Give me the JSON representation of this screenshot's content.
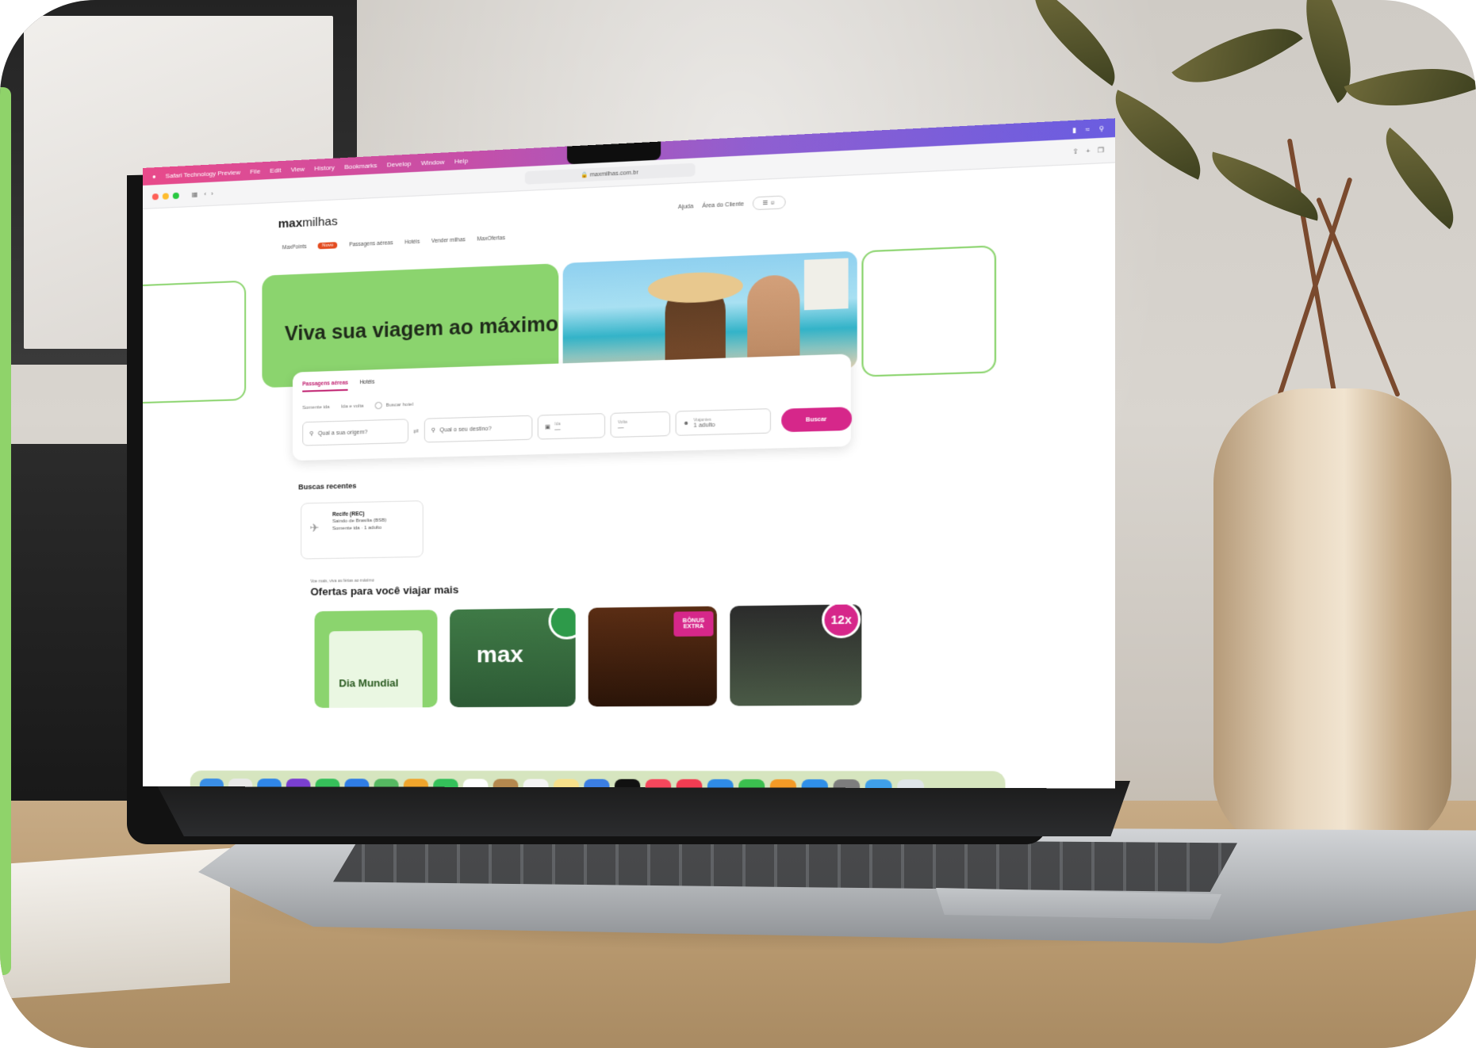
{
  "browser": {
    "menubar_items": [
      "Safari Technology Preview",
      "File",
      "Edit",
      "View",
      "History",
      "Bookmarks",
      "Develop",
      "Window",
      "Help"
    ],
    "url": "maxmilhas.com.br"
  },
  "site": {
    "logo_bold": "max",
    "logo_rest": "milhas",
    "header_links": [
      "Ajuda",
      "Área do Cliente"
    ],
    "nav_items": [
      "MaxPoints",
      "Passagens aéreas",
      "Hotéis",
      "Vender milhas",
      "MaxOfertas"
    ],
    "nav_new_badge": "Novo",
    "hero_title": "Viva sua viagem ao máximo",
    "search": {
      "tabs": [
        "Passagens aéreas",
        "Hotéis"
      ],
      "options": [
        "Somente ida",
        "Ida e volta",
        "Buscar hotel"
      ],
      "origin_placeholder": "Qual a sua origem?",
      "destination_placeholder": "Qual o seu destino?",
      "date_out_label": "Ida",
      "date_back_label": "Volta",
      "travelers_label": "Viajantes",
      "travelers_value": "1 adulto",
      "button": "Buscar"
    },
    "recent_title": "Buscas recentes",
    "recent_card": {
      "title": "Recife (REC)",
      "line1": "Saindo de Brasília (BSB)",
      "line2": "Somente ida · 1 adulto"
    },
    "offers_subtitle": "Voe mais, viva as férias ao máximo",
    "offers_title": "Ofertas para você viajar mais",
    "offer_cards": [
      {
        "label": "Dia Mundial"
      },
      {
        "label": "max"
      },
      {
        "label": "BÔNUS EXTRA"
      },
      {
        "label": "12x"
      }
    ]
  },
  "colors": {
    "brand_green": "#8bd46e",
    "brand_magenta": "#d6278a"
  }
}
